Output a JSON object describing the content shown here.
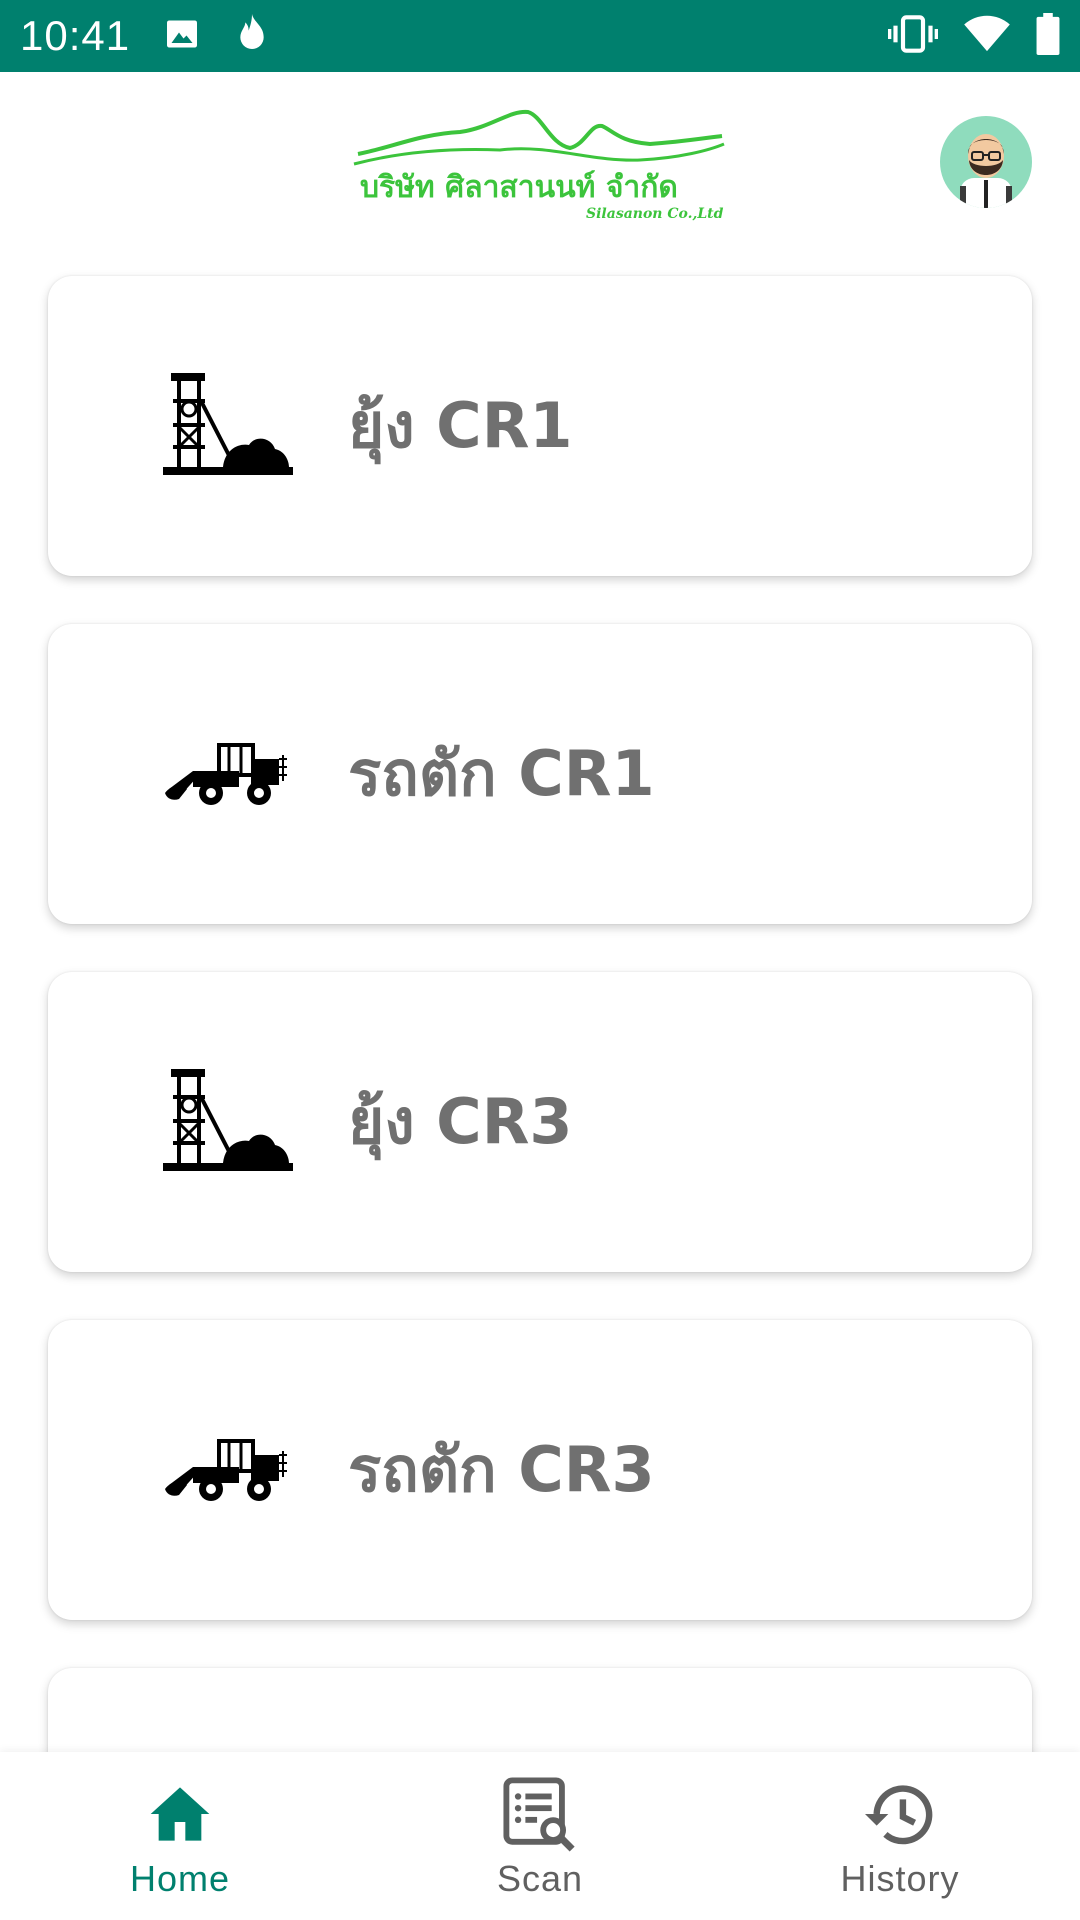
{
  "status_bar": {
    "time": "10:41",
    "left_icons": [
      "image-icon",
      "flame-icon"
    ],
    "right_icons": [
      "vibrate-icon",
      "wifi-icon",
      "battery-icon"
    ]
  },
  "header": {
    "logo_text": "บริษัท ศิลาสานนท์ จำกัด",
    "logo_subtext": "Silasanon Co.,Ltd",
    "logo_color": "#3cc43c",
    "avatar": "avatar-man-beard-glasses"
  },
  "cards": [
    {
      "icon": "mine-tower-icon",
      "label": "ยุ้ง CR1"
    },
    {
      "icon": "wheel-loader-icon",
      "label": "รถตัก CR1"
    },
    {
      "icon": "mine-tower-icon",
      "label": "ยุ้ง CR3"
    },
    {
      "icon": "wheel-loader-icon",
      "label": "รถตัก CR3"
    },
    {
      "icon": "",
      "label": ""
    }
  ],
  "bottom_nav": {
    "items": [
      {
        "icon": "home-icon",
        "label": "Home",
        "active": true
      },
      {
        "icon": "scan-list-icon",
        "label": "Scan",
        "active": false
      },
      {
        "icon": "history-icon",
        "label": "History",
        "active": false
      }
    ],
    "active_color": "#00806e",
    "inactive_color": "#606060"
  },
  "colors": {
    "status_bar": "#00806e",
    "card_label": "#707070"
  }
}
